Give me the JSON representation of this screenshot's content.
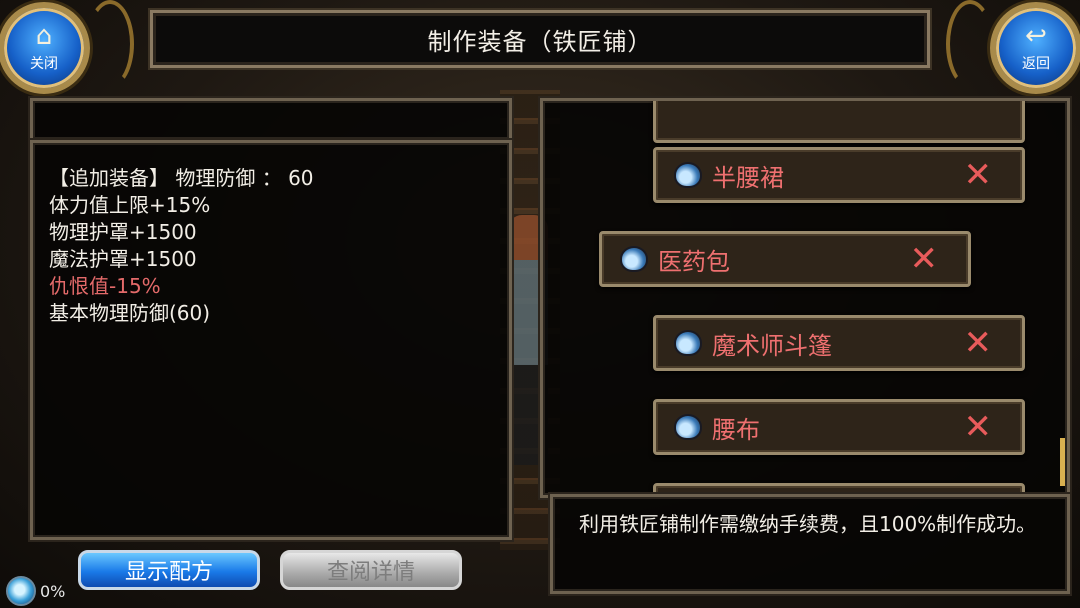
{
  "header": {
    "title": "制作装备（铁匠铺）"
  },
  "nav": {
    "close": {
      "icon": "home-icon",
      "label": "关闭"
    },
    "back": {
      "icon": "return-arrow-icon",
      "label": "返回"
    }
  },
  "detail": {
    "lines": [
      {
        "text": "【追加装备】 物理防御 ：  60",
        "color": "#f2eee6"
      },
      {
        "text": "体力值上限+15%",
        "color": "#f2eee6"
      },
      {
        "text": "物理护罩+1500",
        "color": "#f2eee6"
      },
      {
        "text": "魔法护罩+1500",
        "color": "#f2eee6"
      },
      {
        "text": "仇恨值-15%",
        "color": "#e46a6a"
      },
      {
        "text": "基本物理防御(60)",
        "color": "#f2eee6"
      }
    ]
  },
  "recipes": {
    "items": [
      {
        "name": "半腰裙",
        "icon": "bag-icon",
        "remove_icon": "close-x-icon",
        "selected": false
      },
      {
        "name": "医药包",
        "icon": "bag-icon",
        "remove_icon": "close-x-icon",
        "selected": true
      },
      {
        "name": "魔术师斗篷",
        "icon": "bag-icon",
        "remove_icon": "close-x-icon",
        "selected": false
      },
      {
        "name": "腰布",
        "icon": "bag-icon",
        "remove_icon": "close-x-icon",
        "selected": false
      }
    ],
    "remove_glyph": "✕"
  },
  "note": {
    "text": "利用铁匠铺制作需缴纳手续费，且100%制作成功。"
  },
  "buttons": {
    "show_recipe": "显示配方",
    "view_details": "查阅详情"
  },
  "progress": {
    "percent_label": "0%",
    "value": 0
  },
  "colors": {
    "accent_blue": "#1a7ae8",
    "highlight_red": "#e46a6a",
    "frame_gold": "#a88a4a"
  }
}
